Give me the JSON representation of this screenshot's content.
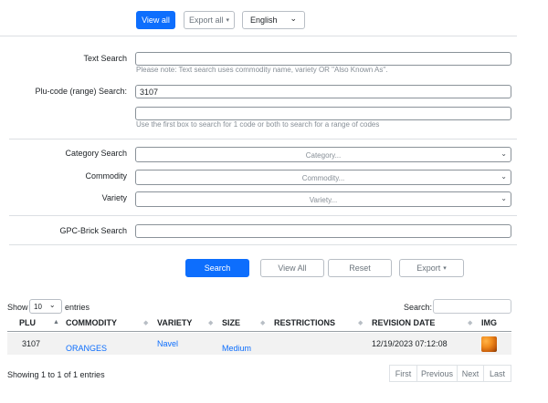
{
  "toolbar": {
    "view_all": "View all",
    "export_all": "Export all",
    "export_caret": "▾",
    "language": "English",
    "language_caret": "⌄"
  },
  "form": {
    "text_search_label": "Text Search",
    "text_search_value": "",
    "text_search_help": "Please note: Text search uses commodity name, variety OR \"Also Known As\".",
    "plu_label": "Plu-code (range) Search:",
    "plu_value_1": "3107",
    "plu_value_2": "",
    "plu_help": "Use the first box to search for 1 code or both to search for a range of codes",
    "category_label": "Category Search",
    "category_placeholder": "Category...",
    "commodity_label": "Commodity",
    "commodity_placeholder": "Commodity...",
    "variety_label": "Variety",
    "variety_placeholder": "Variety...",
    "gpc_label": "GPC-Brick Search",
    "gpc_value": ""
  },
  "actions": {
    "search": "Search",
    "view_all": "View All",
    "reset": "Reset",
    "export": "Export",
    "export_caret": "▾"
  },
  "table_controls": {
    "show": "Show",
    "length_value": "10",
    "entries": "entries",
    "search_label": "Search:",
    "search_value": ""
  },
  "table": {
    "headers": [
      "PLU",
      "COMMODITY",
      "VARIETY",
      "SIZE",
      "RESTRICTIONS",
      "REVISION DATE",
      "IMG"
    ],
    "rows": [
      {
        "plu": "3107",
        "commodity": "ORANGES",
        "variety": "Navel",
        "size": "Medium",
        "restrictions": "",
        "revision_date": "12/19/2023 07:12:08",
        "img": "orange-thumbnail"
      }
    ]
  },
  "footer": {
    "info": "Showing 1 to 1 of 1 entries",
    "pagination": [
      "First",
      "Previous",
      "Next",
      "Last"
    ]
  },
  "colors": {
    "primary": "#0d6efd",
    "row_stripe": "#f2f2f2"
  }
}
